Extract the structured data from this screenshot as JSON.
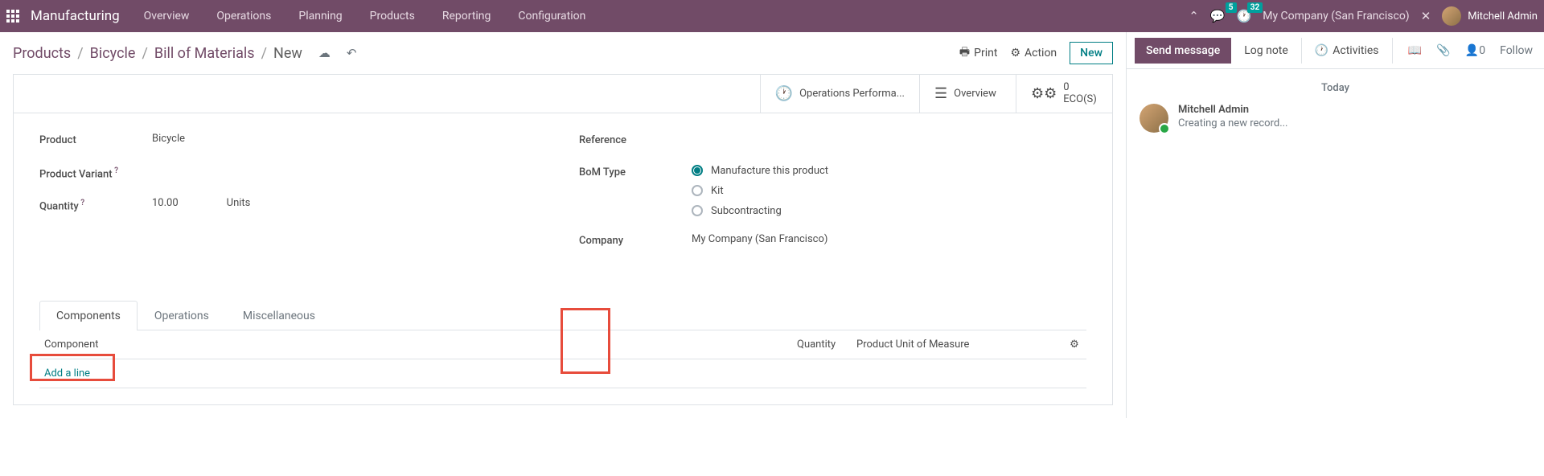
{
  "nav": {
    "app": "Manufacturing",
    "items": [
      "Overview",
      "Operations",
      "Planning",
      "Products",
      "Reporting",
      "Configuration"
    ],
    "messages_badge": "5",
    "clock_badge": "32",
    "company": "My Company (San Francisco)",
    "user": "Mitchell Admin"
  },
  "breadcrumb": {
    "items": [
      "Products",
      "Bicycle",
      "Bill of Materials"
    ],
    "current": "New"
  },
  "cp": {
    "print": "Print",
    "action": "Action",
    "new": "New"
  },
  "stats": {
    "op_label": "Operations Performa...",
    "overview": "Overview",
    "eco_num": "0",
    "eco_label": "ECO(S)"
  },
  "form": {
    "product_label": "Product",
    "product_value": "Bicycle",
    "variant_label": "Product Variant",
    "quantity_label": "Quantity",
    "quantity_value": "10.00",
    "quantity_unit": "Units",
    "reference_label": "Reference",
    "bomtype_label": "BoM Type",
    "bomtype_opts": [
      "Manufacture this product",
      "Kit",
      "Subcontracting"
    ],
    "company_label": "Company",
    "company_value": "My Company (San Francisco)"
  },
  "tabs": [
    "Components",
    "Operations",
    "Miscellaneous"
  ],
  "table": {
    "col_component": "Component",
    "col_quantity": "Quantity",
    "col_uom": "Product Unit of Measure",
    "add_line": "Add a line"
  },
  "chatter": {
    "send": "Send message",
    "log": "Log note",
    "activities": "Activities",
    "followers": "0",
    "follow": "Follow",
    "today": "Today",
    "msg_author": "Mitchell Admin",
    "msg_text": "Creating a new record..."
  }
}
